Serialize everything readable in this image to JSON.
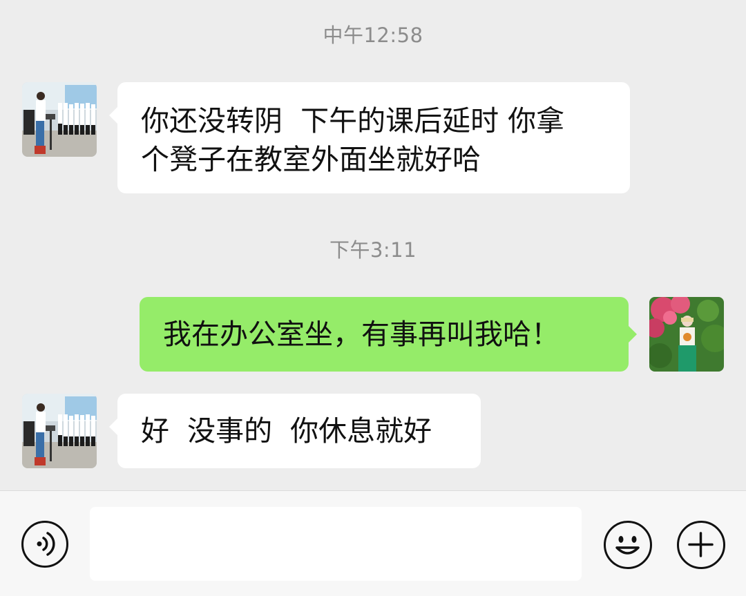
{
  "messages": [
    {
      "timestamp": "中午12:58",
      "direction": "incoming",
      "lines": [
        "你还没转阴  下午的课后延时 你拿",
        "个凳子在教室外面坐就好哈"
      ]
    },
    {
      "timestamp": "下午3:11",
      "direction": "outgoing",
      "lines": [
        "我在办公室坐，有事再叫我哈！"
      ]
    },
    {
      "direction": "incoming",
      "lines": [
        "好  没事的  你休息就好"
      ]
    }
  ],
  "input": {
    "value": "",
    "placeholder": ""
  },
  "icons": {
    "voice": "voice-input-icon",
    "emoji": "emoji-icon",
    "more": "plus-icon"
  },
  "colors": {
    "background": "#ededed",
    "incoming_bubble": "#ffffff",
    "outgoing_bubble": "#95ec69"
  }
}
